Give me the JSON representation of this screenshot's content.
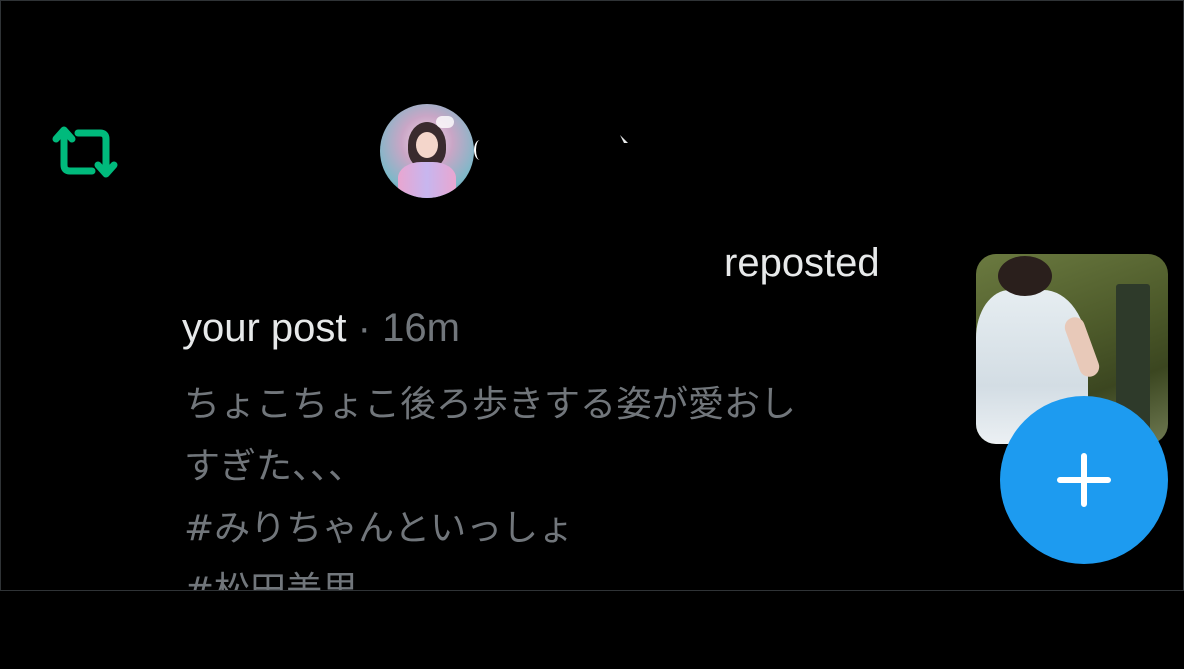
{
  "notification": {
    "type_icon": "repost-icon",
    "reposted_label": "reposted",
    "target_label": "your post",
    "separator": "·",
    "time_ago": "16m",
    "body_lines": [
      "ちょこちょこ後ろ歩きする姿が愛おし",
      "すぎた、、、",
      "#みりちゃんといっしょ",
      "#松田美里"
    ]
  },
  "fab": {
    "icon": "plus-icon"
  },
  "colors": {
    "background": "#000000",
    "primary_text": "#e7e9ea",
    "secondary_text": "#71767b",
    "repost_green": "#00ba7c",
    "accent_blue": "#1d9bf0",
    "divider": "#2f3336"
  }
}
